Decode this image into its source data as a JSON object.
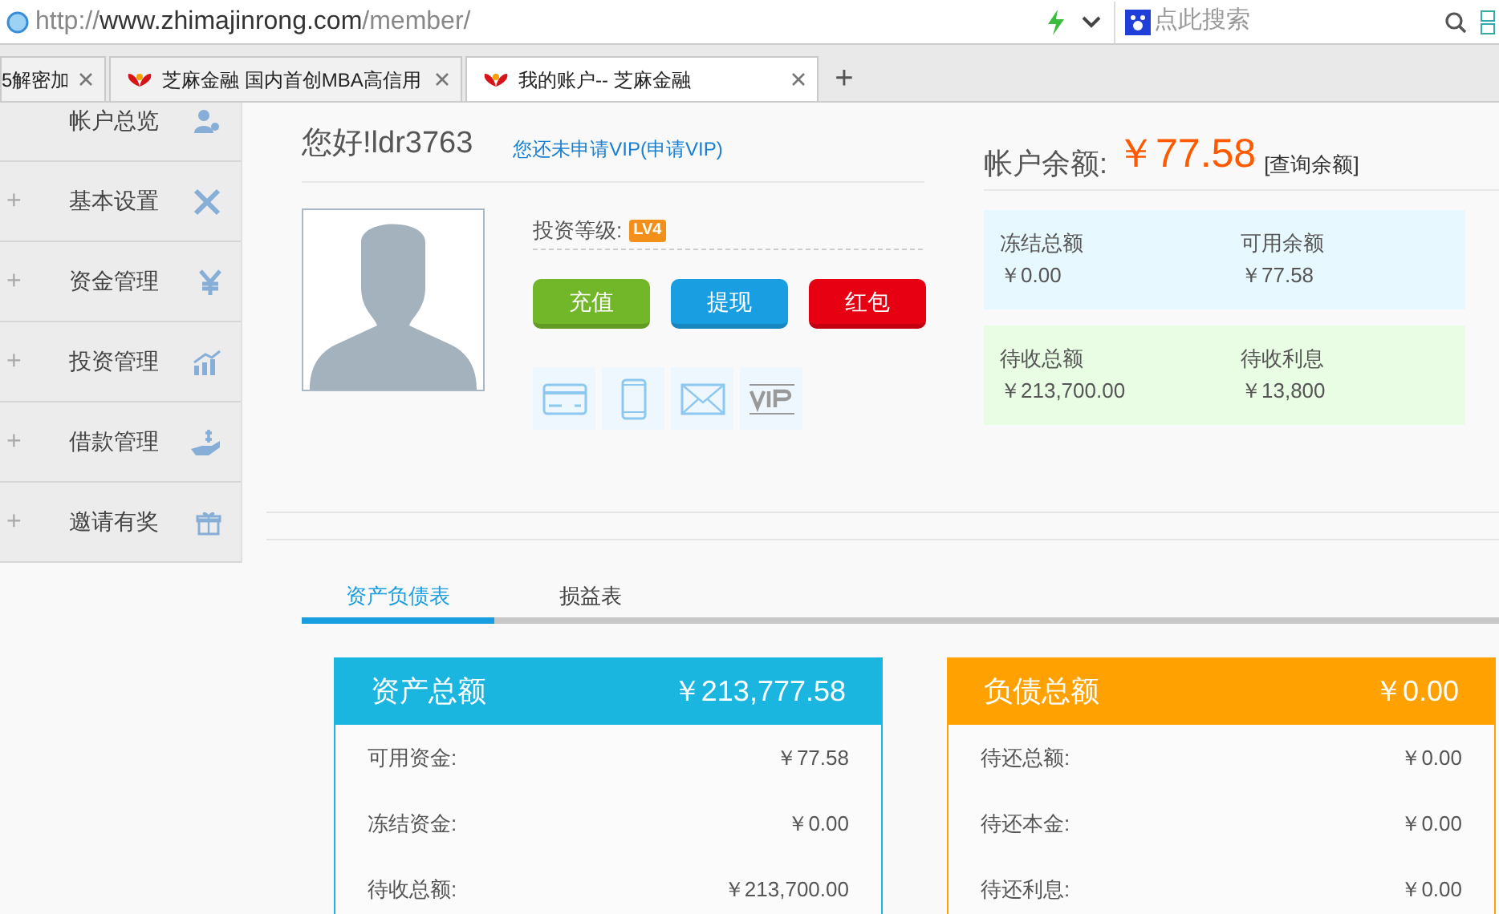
{
  "browser": {
    "url_host": "http://www.zhimajinrong.com",
    "url_path": "/member/",
    "search_placeholder": "点此搜索",
    "tabs": [
      {
        "label": "5解密加",
        "selected": false
      },
      {
        "label": "芝麻金融 国内首创MBA高信用",
        "selected": false
      },
      {
        "label": "我的账户-- 芝麻金融",
        "selected": true
      }
    ],
    "new_tab": "+"
  },
  "sidebar": {
    "items": [
      {
        "label": "帐户总览",
        "expandable": false
      },
      {
        "label": "基本设置",
        "expandable": true
      },
      {
        "label": "资金管理",
        "expandable": true
      },
      {
        "label": "投资管理",
        "expandable": true
      },
      {
        "label": "借款管理",
        "expandable": true
      },
      {
        "label": "邀请有奖",
        "expandable": true
      }
    ],
    "expand_mark": "+"
  },
  "profile": {
    "greeting": "您好!ldr3763",
    "vip_notice": "您还未申请VIP",
    "vip_link": "(申请VIP)",
    "level_label": "投资等级:",
    "level_badge": "LV4",
    "buttons": [
      {
        "label": "充值",
        "color": "#72b72a"
      },
      {
        "label": "提现",
        "color": "#1a9ee2"
      },
      {
        "label": "红包",
        "color": "#e60012"
      }
    ]
  },
  "balance": {
    "label": "帐户余额:",
    "amount": "￥77.58",
    "query_link": "[查询余额]",
    "panels": [
      {
        "color": "#e8f8ff",
        "items": [
          {
            "label": "冻结总额",
            "value": "￥0.00"
          },
          {
            "label": "可用余额",
            "value": "￥77.58"
          }
        ]
      },
      {
        "color": "#e8fde3",
        "items": [
          {
            "label": "待收总额",
            "value": "￥213,700.00"
          },
          {
            "label": "待收利息",
            "value": "￥13,800"
          }
        ]
      }
    ]
  },
  "report_tabs": [
    {
      "label": "资产负债表",
      "selected": true
    },
    {
      "label": "损益表",
      "selected": false
    }
  ],
  "summary_cards": [
    {
      "title": "资产总额",
      "total": "￥213,777.58",
      "color": "#1bb6e0",
      "rows": [
        {
          "label": "可用资金:",
          "value": "￥77.58"
        },
        {
          "label": "冻结资金:",
          "value": "￥0.00"
        },
        {
          "label": "待收总额:",
          "value": "￥213,700.00"
        }
      ]
    },
    {
      "title": "负债总额",
      "total": "￥0.00",
      "color": "#ffa100",
      "rows": [
        {
          "label": "待还总额:",
          "value": "￥0.00"
        },
        {
          "label": "待还本金:",
          "value": "￥0.00"
        },
        {
          "label": "待还利息:",
          "value": "￥0.00"
        }
      ]
    }
  ]
}
